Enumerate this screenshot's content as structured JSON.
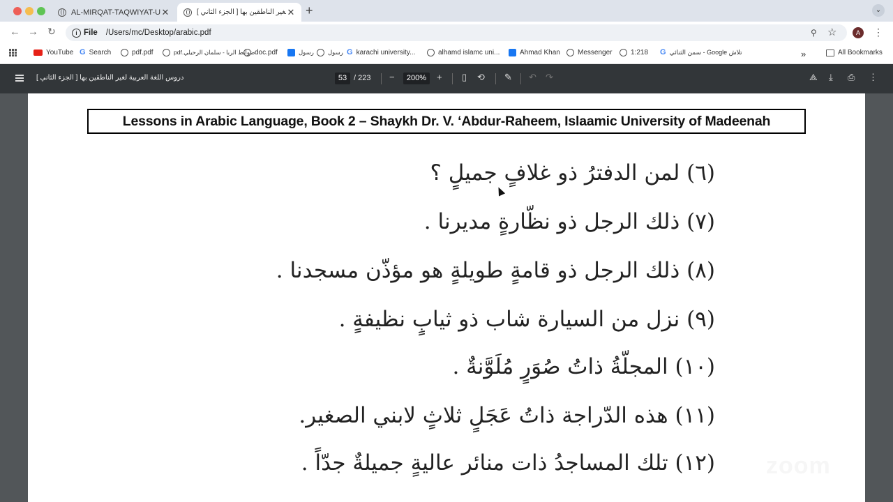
{
  "window": {
    "tabs": [
      {
        "title": "AL-MIRQAT-TAQWIYAT-UL-M",
        "close": "✕"
      },
      {
        "title": "دروس اللغة العربية لغير الناطقين بها [ الجزء الثاني ]",
        "close": "✕"
      }
    ],
    "new_tab": "+"
  },
  "address_bar": {
    "scheme_label": "File",
    "url": "/Users/mc/Desktop/arabic.pdf",
    "avatar_letter": "A"
  },
  "bookmarks": [
    {
      "label": "YouTube",
      "icon": "youtube-icon"
    },
    {
      "label": "Search",
      "icon": "google-icon"
    },
    {
      "label": "pdf.pdf",
      "icon": "globe-icon"
    },
    {
      "label": "pdf.ضوابط الربا - سلمان الرحيلي",
      "icon": "globe-icon"
    },
    {
      "label": "doc.pdf",
      "icon": "globe-icon"
    },
    {
      "label": "رسول",
      "icon": "facebook-icon"
    },
    {
      "label": "رسول",
      "icon": "globe-icon"
    },
    {
      "label": "karachi university...",
      "icon": "google-icon"
    },
    {
      "label": "alhamd islamc uni...",
      "icon": "globe-icon"
    },
    {
      "label": "Ahmad Khan",
      "icon": "facebook-icon"
    },
    {
      "label": "Messenger",
      "icon": "globe-icon"
    },
    {
      "label": "1:218",
      "icon": "globe-icon"
    },
    {
      "label": "سمن الثنائي - Google تلاش",
      "icon": "google-icon"
    }
  ],
  "bookmarks_more": "»",
  "all_bookmarks": "All Bookmarks",
  "pdf_toolbar": {
    "title": "دروس اللغة العربية لغير الناطقين بها [ الجزء الثاني ]",
    "page_current": "53",
    "page_total": "/ 223",
    "zoom": "200%",
    "zoom_out": "−",
    "zoom_in": "+"
  },
  "page": {
    "header": "Lessons in Arabic Language, Book 2 – Shaykh Dr. V. ‘Abdur-Raheem, Islaamic University of Madeenah",
    "lines": [
      "(٦) لمن الدفترُ ذو غلافٍ جميلٍ ؟",
      "(٧) ذلك الرجل ذو نظّارةٍ مديرنا .",
      "(٨) ذلك الرجل ذو قامةٍ طويلةٍ هو مؤذّن مسجدنا .",
      "(٩) نزل من السيارة شاب ذو ثيابٍ نظيفةٍ .",
      "(١٠) المجلّةُ ذاتُ صُوَرٍ مُلَوَّنةٌ .",
      "(١١) هذه الدّراجة ذاتُ عَجَلٍ ثلاثٍ لابني الصغير.",
      "(١٢) تلك المساجدُ ذات منائر عاليةٍ جميلةٌ جدّاً ."
    ],
    "watermark": "zoom"
  }
}
